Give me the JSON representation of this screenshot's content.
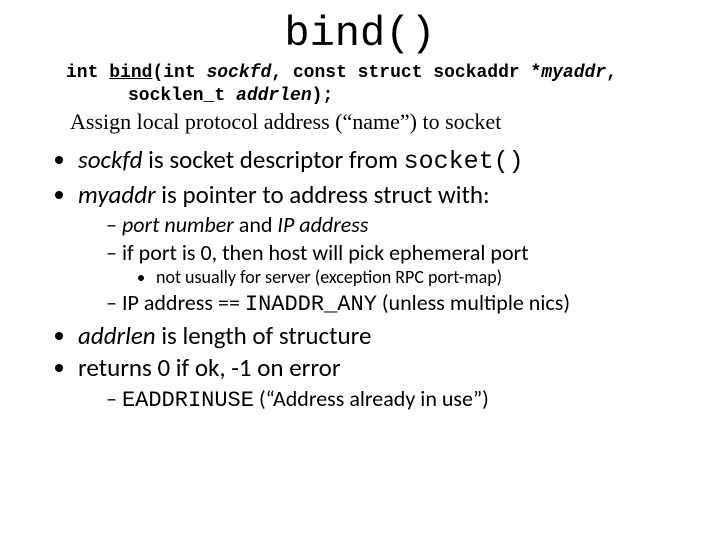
{
  "title": "bind()",
  "signature": {
    "l1a": "int ",
    "l1b": "bind",
    "l1c": "(int ",
    "l1d": "sockfd",
    "l1e": ", const struct sockaddr *",
    "l1f": "myaddr",
    "l1g": ",",
    "l2a": "socklen_t ",
    "l2b": "addrlen",
    "l2c": ");"
  },
  "desc": "Assign local protocol address (“name”) to socket",
  "b1": {
    "i0a": "sockfd",
    "i0b": " is socket descriptor from ",
    "i0c": "socket()",
    "i1a": "myaddr",
    "i1b": " is pointer to address struct with:",
    "i2a": "addrlen",
    "i2b": " is length of structure",
    "i3": "returns 0 if ok, -1 on error"
  },
  "b2": {
    "s0a": "port number",
    "s0b": " and ",
    "s0c": "IP address",
    "s1": "if port is 0, then host will pick ephemeral port",
    "s2a": "IP address == ",
    "s2b": "INADDR_ANY",
    "s2c": " (unless multiple nics)",
    "s3a": "EADDRINUSE",
    "s3b": " (“Address already in use”)"
  },
  "b3": {
    "n0": "not usually for server (exception RPC port-map)"
  }
}
